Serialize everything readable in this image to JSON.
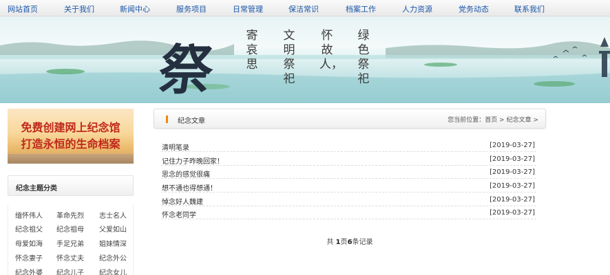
{
  "nav": {
    "items": [
      "网站首页",
      "关于我们",
      "新闻中心",
      "服务项目",
      "日常管理",
      "保洁常识",
      "档案工作",
      "人力资源",
      "党务动态",
      "联系我们"
    ]
  },
  "banner": {
    "big_char": "祭",
    "poem_columns": [
      "绿色祭祀",
      "怀故人，",
      "文明祭祀",
      "寄哀思"
    ]
  },
  "sidebar": {
    "promo_line1": "免费创建网上纪念馆",
    "promo_line2": "打造永恒的生命档案",
    "category_title": "纪念主题分类",
    "categories": [
      "缅怀伟人",
      "革命先烈",
      "志士名人",
      "纪念祖父",
      "纪念祖母",
      "父爱如山",
      "母爱如海",
      "手足兄弟",
      "姐妹情深",
      "怀念妻子",
      "怀念丈夫",
      "纪念外公",
      "纪念外婆",
      "纪念儿子",
      "纪念女儿"
    ]
  },
  "main": {
    "title": "纪念文章",
    "breadcrumb_prefix": "您当前位置：",
    "breadcrumb_home": "首页",
    "breadcrumb_sep1": " > ",
    "breadcrumb_current": "纪念文章",
    "breadcrumb_sep2": " >",
    "articles": [
      {
        "title": "清明笔录",
        "date": "[2019-03-27]"
      },
      {
        "title": "记住力子昨晚回家！",
        "date": "[2019-03-27]"
      },
      {
        "title": "思念的感觉很痛",
        "date": "[2019-03-27]"
      },
      {
        "title": "想不通也得想通！",
        "date": "[2019-03-27]"
      },
      {
        "title": "悼念好人魏建",
        "date": "[2019-03-27]"
      },
      {
        "title": "怀念老同学",
        "date": "[2019-03-27]"
      }
    ],
    "pager": {
      "prefix": "共 ",
      "pages": "1",
      "mid": "页",
      "records": "6",
      "suffix": "条记录"
    }
  },
  "colors": {
    "nav_link": "#1a56a8",
    "accent_mark": "#f08a00",
    "promo_text": "#c0281c"
  }
}
